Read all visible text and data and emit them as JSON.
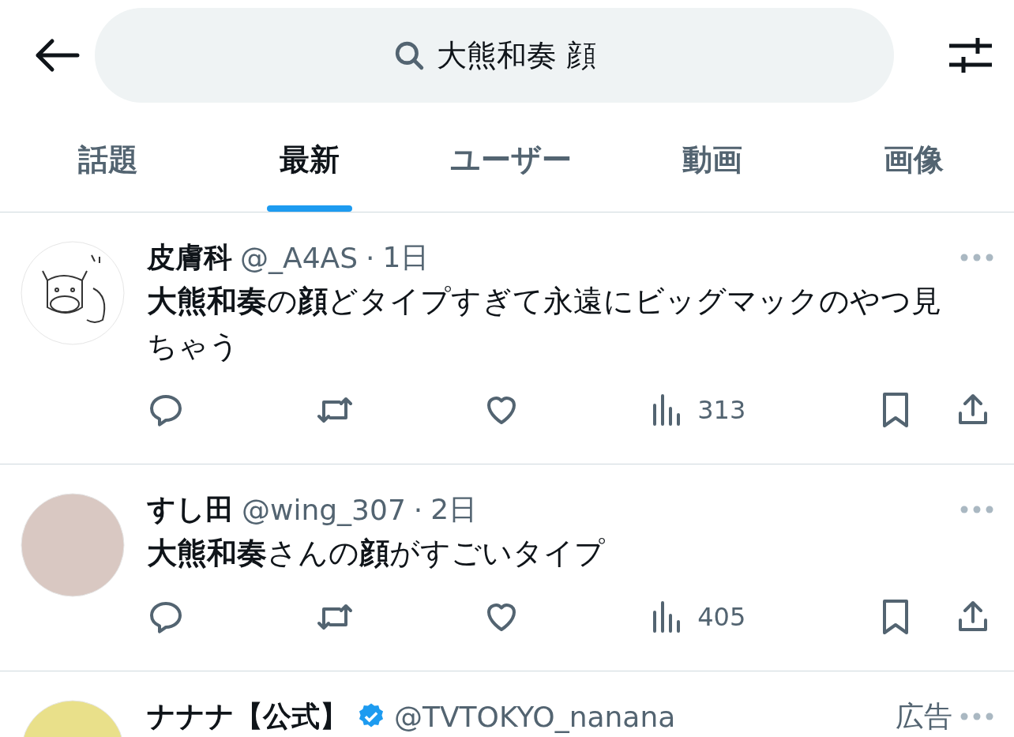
{
  "search": {
    "value": "大熊和奏 顔"
  },
  "tabs": [
    {
      "label": "話題",
      "selected": false
    },
    {
      "label": "最新",
      "selected": true
    },
    {
      "label": "ユーザー",
      "selected": false
    },
    {
      "label": "動画",
      "selected": false
    },
    {
      "label": "画像",
      "selected": false
    }
  ],
  "tweets": [
    {
      "kind": "drawing",
      "name": "皮膚科",
      "verified": false,
      "handle": "@_A4AS",
      "separator": "·",
      "time": "1日",
      "text": "**大熊和奏**の**顔**どタイプすぎて永遠にビッグマックのやつ見ちゃう",
      "views": "313"
    },
    {
      "kind": "photo",
      "name": "すし田",
      "verified": false,
      "handle": "@wing_307",
      "separator": "·",
      "time": "2日",
      "text": "**大熊和奏**さんの**顔**がすごいタイプ",
      "views": "405"
    },
    {
      "kind": "mascot",
      "name": "ナナナ【公式】",
      "verified": true,
      "handle": "@TVTOKYO_nanana",
      "ad_label": "広告"
    }
  ]
}
